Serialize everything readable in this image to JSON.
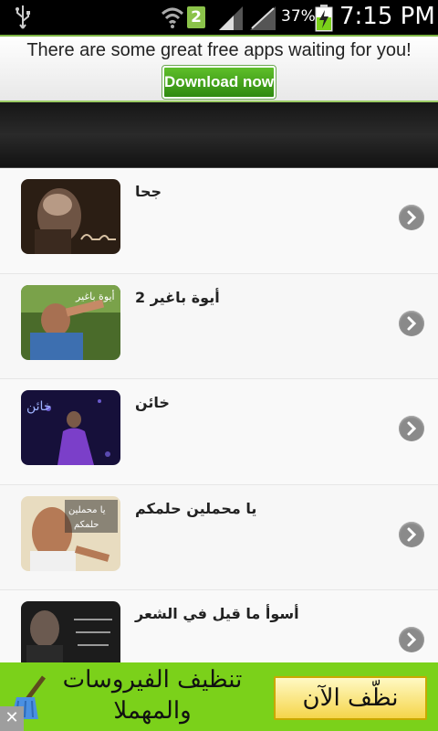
{
  "status_bar": {
    "badge": "2",
    "battery": "37%",
    "time": "7:15 PM"
  },
  "ad_top": {
    "text": "There are some great free apps waiting for you!",
    "button": "Download now"
  },
  "list": {
    "items": [
      {
        "title": "جحا"
      },
      {
        "title": "أيوة باغير 2"
      },
      {
        "title": "خائن"
      },
      {
        "title": "يا محملين حلمكم"
      },
      {
        "title": "أسوأ ما قيل في الشعر"
      }
    ]
  },
  "ad_bottom": {
    "text": "تنظيف الفيروسات والمهملا",
    "button": "نظّف الآن",
    "close": "✕"
  },
  "colors": {
    "ad_green": "#7bd11a",
    "download_green": "#2f8a10",
    "clean_yellow": "#f5d54a"
  }
}
